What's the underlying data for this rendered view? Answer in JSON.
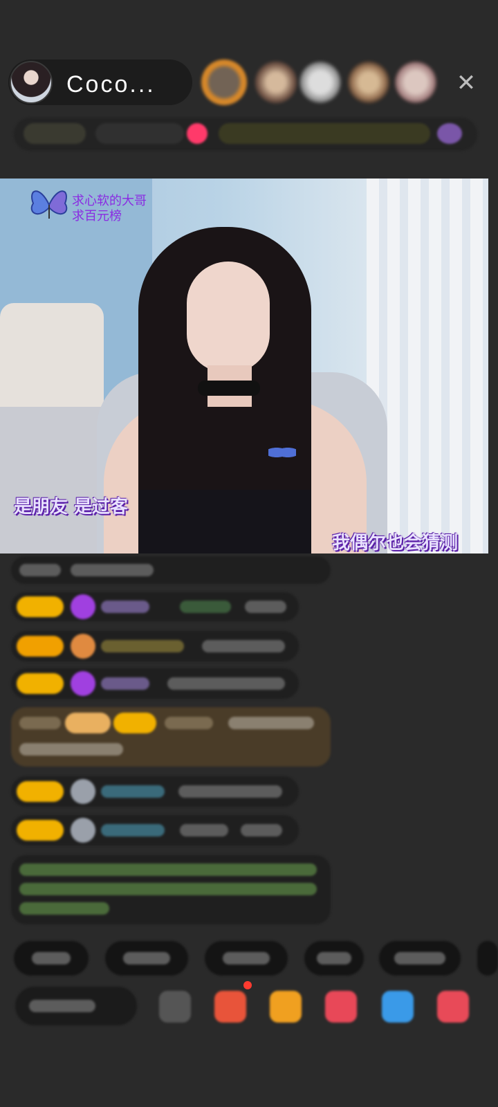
{
  "header": {
    "host_name": "Coco...",
    "close_icon": "close-icon",
    "close_glyph": "✕"
  },
  "video": {
    "overlay_note_line1": "求心软的大哥",
    "overlay_note_line2": "求百元榜",
    "lyric_left": "是朋友  是过客",
    "lyric_right": "我偶尔也会猜测"
  },
  "colors": {
    "accent_badge": "#f1b100",
    "overlay_purple": "#8a2be2",
    "background": "#2a2a2a",
    "gift_row": "#4a3c28"
  }
}
